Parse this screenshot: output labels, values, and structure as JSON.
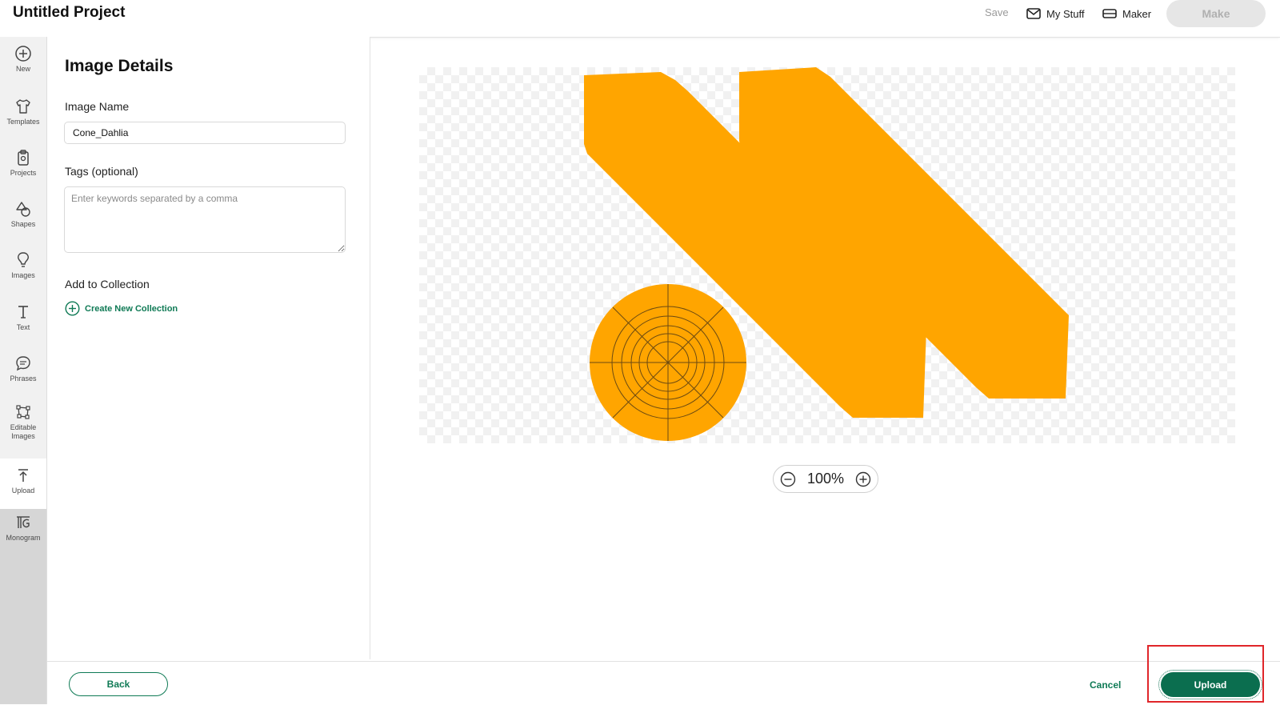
{
  "header": {
    "title": "Untitled Project",
    "save_label": "Save",
    "my_stuff_label": "My Stuff",
    "maker_label": "Maker",
    "make_label": "Make"
  },
  "rail": {
    "items": [
      {
        "label": "New",
        "icon": "plus-circle-icon"
      },
      {
        "label": "Templates",
        "icon": "shirt-icon"
      },
      {
        "label": "Projects",
        "icon": "clipboard-icon"
      },
      {
        "label": "Shapes",
        "icon": "shapes-icon"
      },
      {
        "label": "Images",
        "icon": "lightbulb-icon"
      },
      {
        "label": "Text",
        "icon": "text-icon"
      },
      {
        "label": "Phrases",
        "icon": "speech-bubble-icon"
      },
      {
        "label": "Editable Images",
        "icon": "editable-shape-icon"
      },
      {
        "label": "Upload",
        "icon": "upload-icon"
      },
      {
        "label": "Monogram",
        "icon": "monogram-icon"
      }
    ],
    "active": "Upload"
  },
  "details": {
    "title": "Image Details",
    "name_label": "Image Name",
    "name_value": "Cone_Dahlia",
    "tags_label": "Tags (optional)",
    "tags_placeholder": "Enter keywords separated by a comma",
    "collection_label": "Add to Collection",
    "create_collection_label": "Create New Collection"
  },
  "preview": {
    "shape_color": "#ffa500",
    "zoom": "100%"
  },
  "footer": {
    "back_label": "Back",
    "cancel_label": "Cancel",
    "upload_label": "Upload",
    "accent_color": "#0b6e4f",
    "highlight_color": "#e0262a"
  }
}
